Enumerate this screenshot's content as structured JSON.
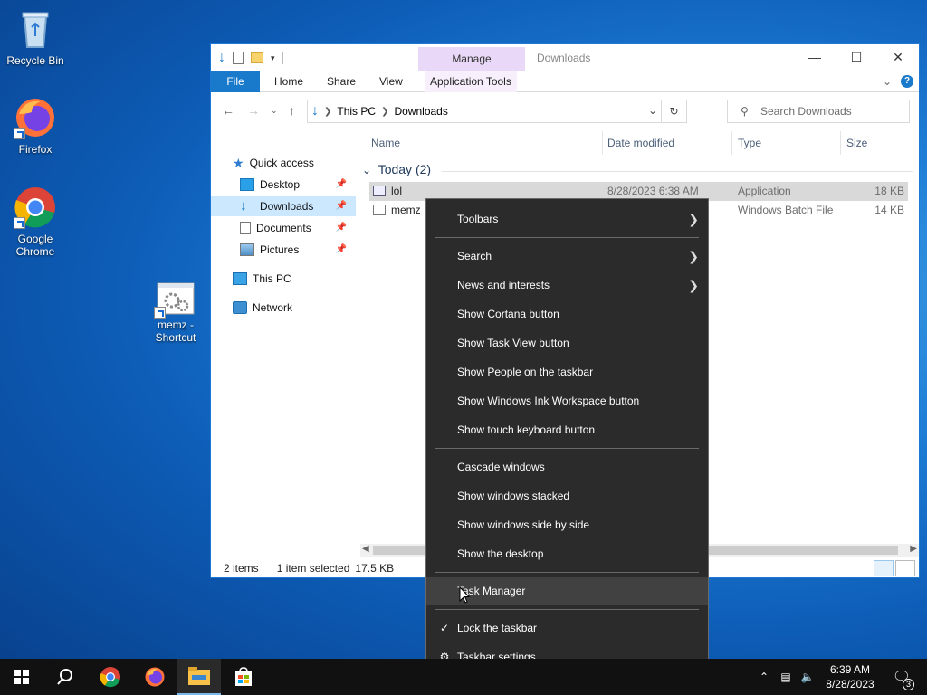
{
  "desktop": {
    "icons": [
      {
        "label": "Recycle Bin"
      },
      {
        "label": "Firefox"
      },
      {
        "label": "Google Chrome"
      },
      {
        "label": "memz - Shortcut"
      }
    ]
  },
  "explorer": {
    "title": "Downloads",
    "manage_tab": "Manage",
    "ribbon_tabs": [
      "File",
      "Home",
      "Share",
      "View",
      "Application Tools"
    ],
    "address": {
      "part1": "This PC",
      "part2": "Downloads"
    },
    "search_placeholder": "Search Downloads",
    "nav": {
      "quick_access": "Quick access",
      "desktop": "Desktop",
      "downloads": "Downloads",
      "documents": "Documents",
      "pictures": "Pictures",
      "this_pc": "This PC",
      "network": "Network"
    },
    "columns": {
      "name": "Name",
      "date": "Date modified",
      "type": "Type",
      "size": "Size"
    },
    "group_label": "Today (2)",
    "files": [
      {
        "name": "lol",
        "date": "8/28/2023 6:38 AM",
        "type": "Application",
        "size": "18 KB"
      },
      {
        "name": "memz",
        "date": "",
        "type": "Windows Batch File",
        "size": "14 KB"
      }
    ],
    "status": {
      "items": "2 items",
      "selected": "1 item selected",
      "size": "17.5 KB"
    }
  },
  "context_menu": {
    "toolbars": "Toolbars",
    "search": "Search",
    "news": "News and interests",
    "cortana": "Show Cortana button",
    "task_view": "Show Task View button",
    "people": "Show People on the taskbar",
    "ink": "Show Windows Ink Workspace button",
    "touch_kb": "Show touch keyboard button",
    "cascade": "Cascade windows",
    "stacked": "Show windows stacked",
    "side_by_side": "Show windows side by side",
    "show_desktop": "Show the desktop",
    "task_manager": "Task Manager",
    "lock": "Lock the taskbar",
    "settings": "Taskbar settings"
  },
  "taskbar": {
    "time": "6:39 AM",
    "date": "8/28/2023",
    "notif_count": "3"
  },
  "colors": {
    "accent": "#1979ca",
    "menu_bg": "#2b2b2b",
    "taskbar_bg": "#111111"
  }
}
